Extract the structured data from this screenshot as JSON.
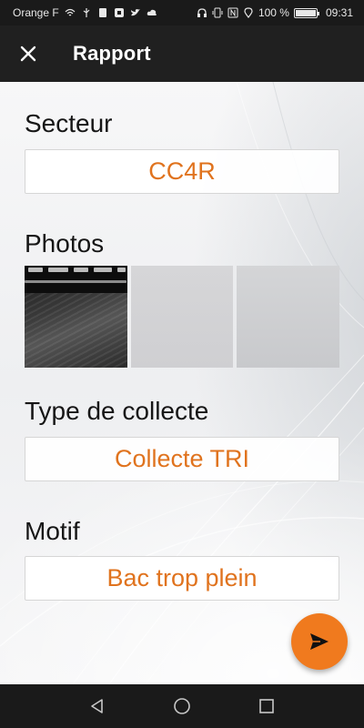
{
  "status_bar": {
    "carrier": "Orange F",
    "battery_percent": "100 %",
    "time": "09:31",
    "icons": [
      "wifi-icon",
      "usb-icon",
      "sim-icon",
      "app-icon",
      "twitter-icon",
      "cloud-icon",
      "headset-icon",
      "vibrate-icon",
      "nfc-icon",
      "location-icon",
      "battery-icon"
    ]
  },
  "app_bar": {
    "title": "Rapport",
    "close_icon": "close-icon"
  },
  "form": {
    "secteur": {
      "label": "Secteur",
      "value": "CC4R"
    },
    "photos": {
      "label": "Photos",
      "count": 3
    },
    "type_collecte": {
      "label": "Type de collecte",
      "value": "Collecte TRI"
    },
    "motif": {
      "label": "Motif",
      "value": "Bac trop plein"
    }
  },
  "fab": {
    "icon": "send-icon"
  },
  "nav_bar": {
    "icons": [
      "back-icon",
      "home-icon",
      "recents-icon"
    ]
  },
  "colors": {
    "accent": "#f07a1e",
    "value_text": "#e0731e",
    "app_bar": "#202020"
  }
}
